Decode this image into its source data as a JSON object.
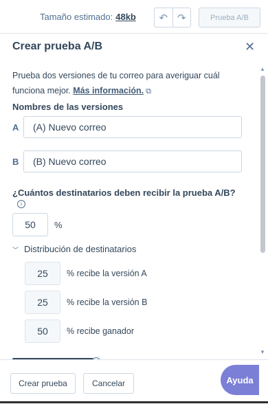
{
  "topbar": {
    "estimated_size_label": "Tamaño estimado:",
    "estimated_size_value": "48kb",
    "undo_icon": "undo-icon",
    "redo_icon": "redo-icon",
    "ab_test_button": "Prueba A/B"
  },
  "panel": {
    "title": "Crear prueba A/B",
    "close_icon": "close-icon",
    "description": "Prueba dos versiones de tu correo para averiguar cuál funciona mejor.",
    "more_info_link": "Más información.",
    "versions_heading": "Nombres de las versiones",
    "version_a_letter": "A",
    "version_a_value": "(A) Nuevo correo",
    "version_b_letter": "B",
    "version_b_value": "(B) Nuevo correo",
    "recipients_question": "¿Cuántos destinatarios deben recibir la prueba A/B?",
    "recipients_percent": "50",
    "percent_sign": "%",
    "distribution_toggle": "Distribución de destinatarios",
    "distribution": [
      {
        "value": "25",
        "label": "% recibe la versión A"
      },
      {
        "value": "25",
        "label": "% recibe la versión B"
      },
      {
        "value": "50",
        "label": "% recibe ganador"
      }
    ]
  },
  "footer": {
    "create_button": "Crear prueba",
    "cancel_button": "Cancelar",
    "help_button": "Ayuda"
  }
}
